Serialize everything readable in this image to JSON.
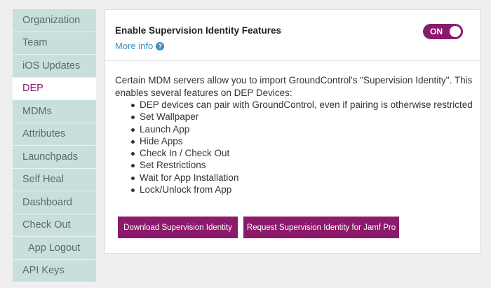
{
  "sidebar": {
    "items": [
      {
        "label": "Organization"
      },
      {
        "label": "Team"
      },
      {
        "label": "iOS Updates"
      },
      {
        "label": "DEP"
      },
      {
        "label": "MDMs"
      },
      {
        "label": "Attributes"
      },
      {
        "label": "Launchpads"
      },
      {
        "label": "Self Heal"
      },
      {
        "label": "Dashboard"
      },
      {
        "label": "Check Out"
      },
      {
        "label": "App Logout"
      },
      {
        "label": "API Keys"
      }
    ],
    "active": "DEP"
  },
  "feature": {
    "title": "Enable Supervision Identity Features",
    "more_info": "More info",
    "help_icon": "?",
    "toggle_label": "ON",
    "toggle_state": true
  },
  "description": {
    "intro": "Certain MDM servers allow you to import GroundControl's \"Supervision Identity\". This enables several features on DEP Devices:",
    "features": [
      "DEP devices can pair with GroundControl, even if pairing is otherwise restricted",
      "Set Wallpaper",
      "Launch App",
      "Hide Apps",
      "Check In / Check Out",
      "Set Restrictions",
      "Wait for App Installation",
      "Lock/Unlock from App"
    ]
  },
  "buttons": {
    "download": "Download Supervision Identity",
    "request": "Request Supervision Identity for Jamf Pro"
  },
  "colors": {
    "accent": "#8b1a6b",
    "sidebar_bg": "#c9dfdc",
    "link": "#3a8fbf"
  }
}
